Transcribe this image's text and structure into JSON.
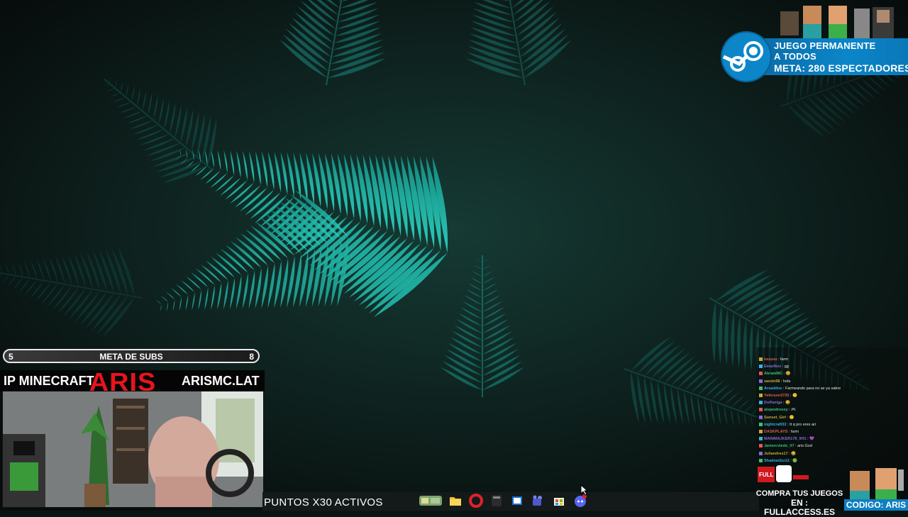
{
  "steam_promo": {
    "line1": "JUEGO PERMANENTE",
    "line2": "A TODOS",
    "meta_label": "META:",
    "meta_value": "280 ESPECTADORES",
    "accent": "#0b86c9"
  },
  "subs_goal": {
    "current": "5",
    "title": "META DE SUBS",
    "target": "8",
    "progress": 0.62
  },
  "minecraft_banner": {
    "label": "IP MINECRAFT",
    "name": "ARIS",
    "domain": "ARISMC.LAT",
    "name_color": "#e8141c"
  },
  "chat": {
    "messages": [
      {
        "user": "luuuuu",
        "text": ": farm"
      },
      {
        "user": "EmarNov",
        "text": ": gg"
      },
      {
        "user": "AbramMC",
        "text": ": 😃"
      },
      {
        "user": "sando98",
        "text": ": hola"
      },
      {
        "user": "Arsaddos",
        "text": ": Farmeando para no se ya sabre"
      },
      {
        "user": "Yeferson3725",
        "text": ": 🙂"
      },
      {
        "user": "Dolfuniga",
        "text": ": 😃"
      },
      {
        "user": "alejandrosxy",
        "text": ": 🎮"
      },
      {
        "user": "Sunset_Girl",
        "text": ": 🙂"
      },
      {
        "user": "nightcraft33",
        "text": ": tt q pro eres ari"
      },
      {
        "user": "DASKPLAYS",
        "text": ": farm"
      },
      {
        "user": "MANIMAJKER178_9H1",
        "text": ": 💜"
      },
      {
        "user": "Javiercviedo_07",
        "text": ": aris God"
      },
      {
        "user": "Juliandres17",
        "text": ": 😃"
      },
      {
        "user": "Shadow2zz12",
        "text": ": 🟢"
      }
    ]
  },
  "taskbar": {
    "ticker": "PUNTOS X30 ACTIVOS",
    "icons": [
      "widgets-icon",
      "file-explorer-icon",
      "opera-browser-icon",
      "calculator-icon",
      "mail-icon",
      "teams-icon",
      "store-icon",
      "discord-icon"
    ]
  },
  "fullaccess": {
    "logo_text": "FULL",
    "line1": "COMPRA TUS JUEGOS",
    "line2": "EN : FULLACCESS.ES",
    "code": "CODIGO: ARIS"
  }
}
